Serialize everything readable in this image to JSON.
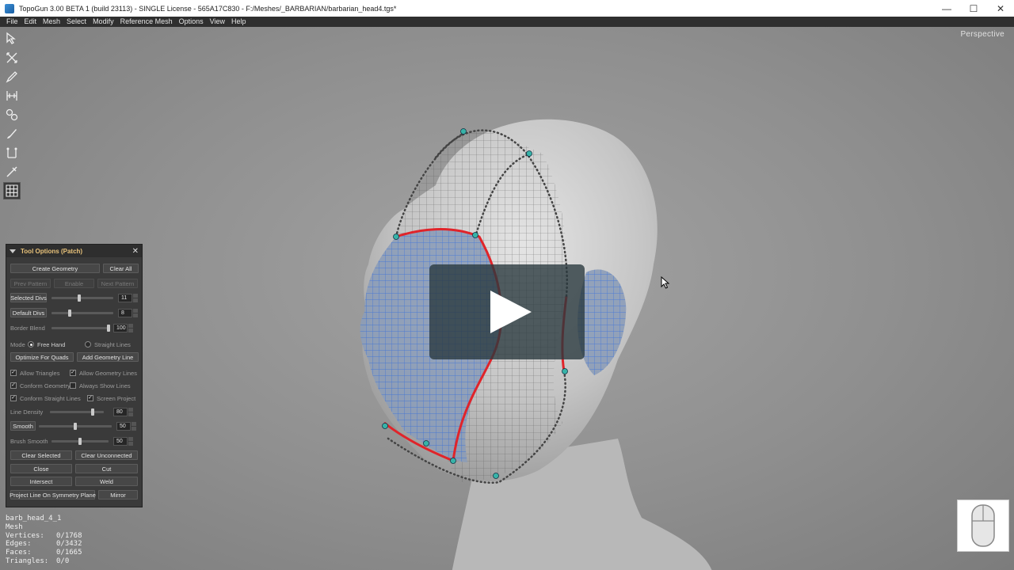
{
  "window": {
    "title": "TopoGun 3.00 BETA 1 (build 23113) - SINGLE License - 565A17C830 - F:/Meshes/_BARBARIAN/barbarian_head4.tgs*",
    "minimize": "—",
    "maximize": "☐",
    "close": "✕"
  },
  "menu": [
    "File",
    "Edit",
    "Mesh",
    "Select",
    "Modify",
    "Reference Mesh",
    "Options",
    "View",
    "Help"
  ],
  "viewport": {
    "label": "Perspective"
  },
  "toolbar": [
    "select-tool-icon",
    "transform-tool-icon",
    "draw-tool-icon",
    "bridge-tool-icon",
    "tubes-tool-icon",
    "brush-tool-icon",
    "edge-loops-tool-icon",
    "knife-tool-icon",
    "patch-tool-icon"
  ],
  "panel": {
    "title": "Tool Options (Patch)",
    "create_geometry": "Create Geometry",
    "clear_all": "Clear All",
    "prev_pattern": "Prev Pattern",
    "enable": "Enable",
    "next_pattern": "Next Pattern",
    "selected_divs": {
      "label": "Selected Divs",
      "value": "11",
      "level": 0.45
    },
    "default_divs": {
      "label": "Default Divs",
      "value": "8",
      "level": 0.3
    },
    "border_blend": {
      "label": "Border Blend",
      "value": "100",
      "level": 1.0
    },
    "mode_label": "Mode",
    "mode_free_hand": "Free Hand",
    "mode_straight_lines": "Straight Lines",
    "optimize_for_quads": "Optimize For Quads",
    "add_geometry_line": "Add Geometry Line",
    "allow_triangles": "Allow Triangles",
    "allow_geometry_lines": "Allow Geometry Lines",
    "conform_geometry": "Conform Geometry",
    "always_show_lines": "Always Show Lines",
    "conform_straight_lines": "Conform Straight Lines",
    "screen_project": "Screen Project",
    "line_density": {
      "label": "Line Density",
      "value": "80",
      "level": 0.8
    },
    "smooth": {
      "label": "Smooth",
      "value": "50",
      "level": 0.5
    },
    "brush_smooth": {
      "label": "Brush Smooth",
      "value": "50",
      "level": 0.5
    },
    "clear_selected": "Clear Selected",
    "clear_unconnected": "Clear Unconnected",
    "close": "Close",
    "cut": "Cut",
    "intersect": "Intersect",
    "weld": "Weld",
    "project_line": "Project Line On Symmetry Plane",
    "mirror": "Mirror"
  },
  "info": {
    "name": "barb_head_4_1",
    "type": "Mesh",
    "vertices_label": "Vertices:",
    "vertices": "0/1768",
    "edges_label": "Edges:",
    "edges": "0/3432",
    "faces_label": "Faces:",
    "faces": "0/1665",
    "triangles_label": "Triangles:",
    "triangles": "0/0"
  },
  "colors": {
    "topology_blue": "#3f73d6",
    "border_red": "#e0242a",
    "vertex_teal": "#37b3a8",
    "panel_title": "#e8c27a"
  }
}
